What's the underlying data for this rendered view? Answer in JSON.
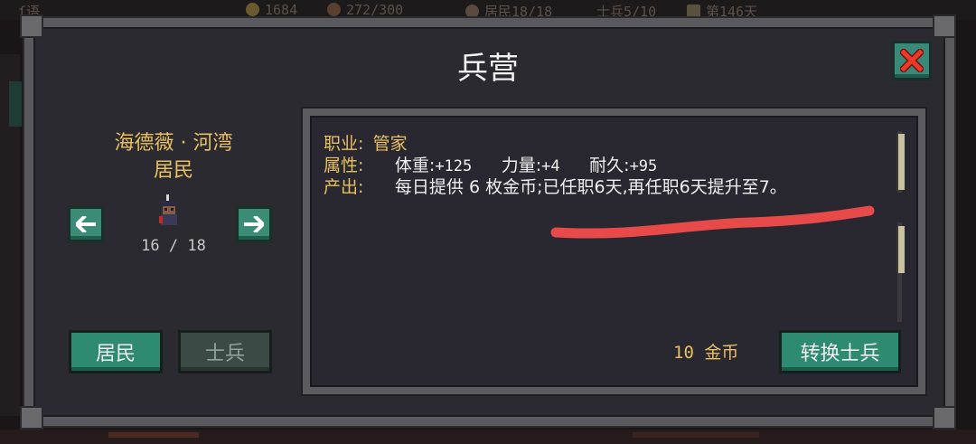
{
  "topbar": {
    "left_text": "ſ语",
    "gold": "1684",
    "food": "272/300",
    "residents": "居民18/18",
    "soldiers": "士兵5/10",
    "day": "第146天"
  },
  "dialog": {
    "title": "兵营",
    "close_icon": "close-x-icon"
  },
  "character": {
    "name": "海德薇 · 河湾",
    "role": "居民",
    "counter": "16 / 18"
  },
  "tabs": [
    {
      "label": "居民",
      "active": true
    },
    {
      "label": "士兵",
      "active": false
    }
  ],
  "info": {
    "job_label": "职业:",
    "job_value": "管家",
    "attr_label": "属性:",
    "weight_label": "体重:",
    "weight_value": "+125",
    "strength_label": "力量:",
    "strength_value": "+4",
    "endurance_label": "耐久:",
    "endurance_value": "+95",
    "output_label": "产出:",
    "output_value": "每日提供 6 枚金币;已任职6天,再任职6天提升至7。"
  },
  "price": "10 金币",
  "convert_button": "转换士兵",
  "colors": {
    "accent": "#2f8a72",
    "label_gold": "#e8c060",
    "annotation_red": "#e84a4a"
  }
}
